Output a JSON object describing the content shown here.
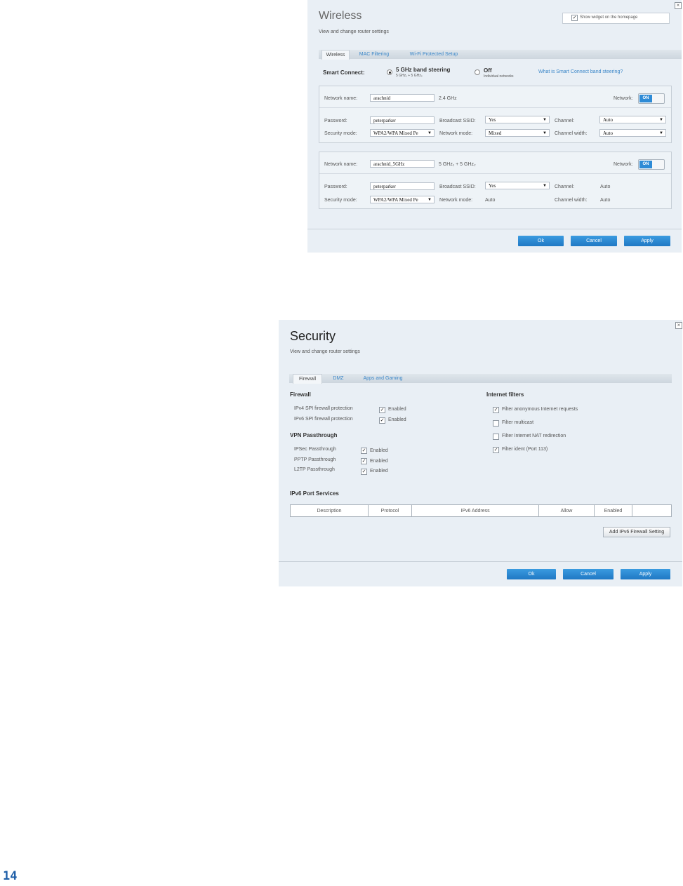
{
  "wireless": {
    "title": "Wireless",
    "subtitle": "View and change router settings",
    "widget_label": "Show widget on the homepage",
    "tabs": [
      "Wireless",
      "MAC Filtering",
      "Wi-Fi Protected Setup"
    ],
    "smart_connect_label": "Smart Connect:",
    "opt1_label": "5 GHz band steering",
    "opt1_sub": "5 GHz₁ + 5 GHz₂",
    "opt2_label": "Off",
    "opt2_sub": "Individual networks",
    "help_link": "What is Smart Connect band steering?",
    "net1": {
      "name_label": "Network name:",
      "name": "arachnid",
      "band": "2.4 GHz",
      "network_label": "Network:",
      "toggle": "ON",
      "password_label": "Password:",
      "password": "peterparker",
      "broadcast_label": "Broadcast SSID:",
      "broadcast": "Yes",
      "channel_label": "Channel:",
      "channel": "Auto",
      "security_label": "Security mode:",
      "security": "WPA2/WPA Mixed Pe",
      "mode_label": "Network mode:",
      "mode": "Mixed",
      "width_label": "Channel width:",
      "width": "Auto"
    },
    "net2": {
      "name_label": "Network name:",
      "name": "arachnid_5GHz",
      "band": "5 GHz₁ + 5 GHz₂",
      "network_label": "Network:",
      "toggle": "ON",
      "password_label": "Password:",
      "password": "peterparker",
      "broadcast_label": "Broadcast SSID:",
      "broadcast": "Yes",
      "channel_label": "Channel:",
      "channel": "Auto",
      "security_label": "Security mode:",
      "security": "WPA2/WPA Mixed Pe",
      "mode_label": "Network mode:",
      "mode": "Auto",
      "width_label": "Channel width:",
      "width": "Auto"
    },
    "buttons": {
      "ok": "Ok",
      "cancel": "Cancel",
      "apply": "Apply"
    }
  },
  "security": {
    "title": "Security",
    "subtitle": "View and change router settings",
    "tabs": [
      "Firewall",
      "DMZ",
      "Apps and Gaming"
    ],
    "firewall_heading": "Firewall",
    "ipv4_label": "IPv4 SPI firewall protection",
    "ipv6_label": "IPv6 SPI firewall protection",
    "enabled": "Enabled",
    "vpn_heading": "VPN Passthrough",
    "ipsec_label": "IPSec Passthrough",
    "pptp_label": "PPTP Passthrough",
    "l2tp_label": "L2TP Passthrough",
    "filters_heading": "Internet filters",
    "filter1": "Filter anonymous Internet requests",
    "filter2": "Filter multicast",
    "filter3": "Filter Internet NAT redirection",
    "filter4": "Filter ident (Port 113)",
    "ipv6_heading": "IPv6 Port Services",
    "columns": [
      "Description",
      "Protocol",
      "IPv6 Address",
      "Allow",
      "Enabled"
    ],
    "add_button": "Add IPv6 Firewall Setting",
    "buttons": {
      "ok": "Ok",
      "cancel": "Cancel",
      "apply": "Apply"
    }
  },
  "page_number": "14"
}
